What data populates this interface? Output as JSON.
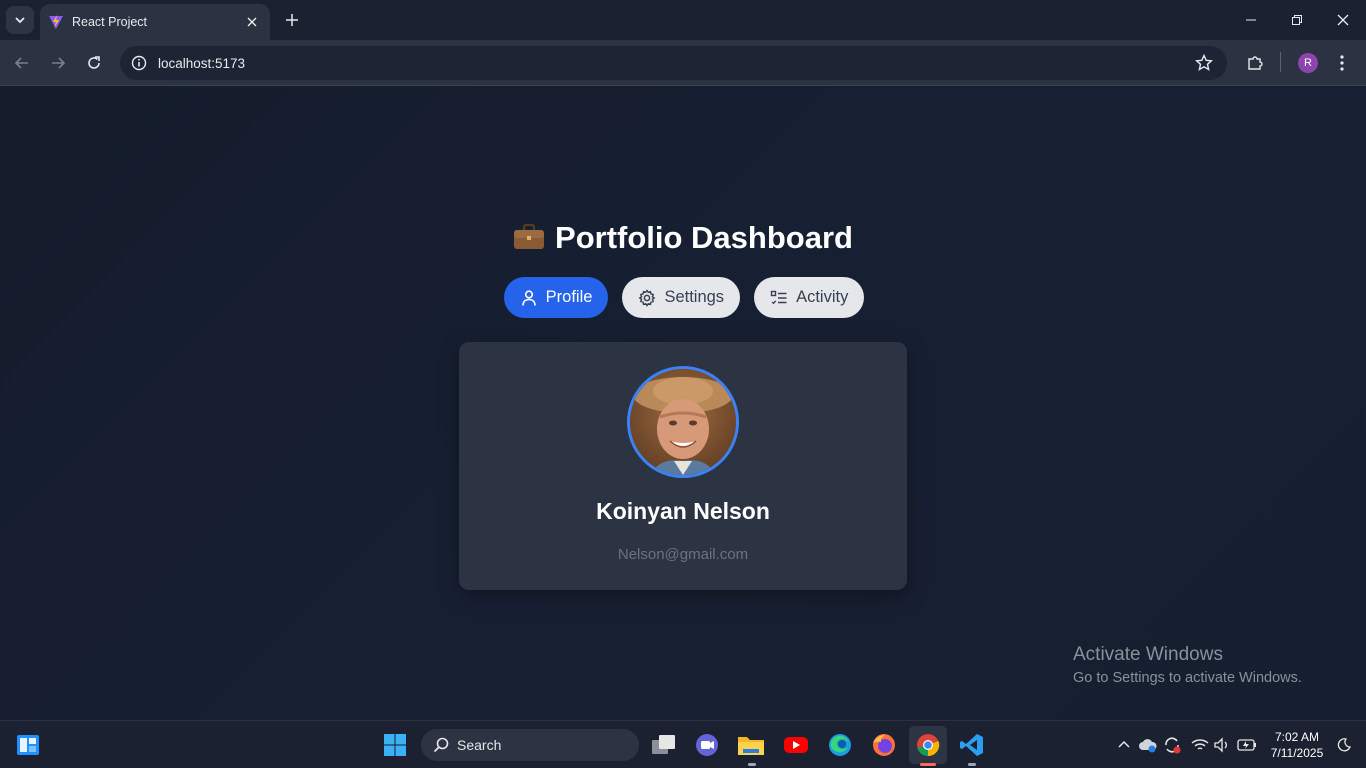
{
  "browser": {
    "tab_title": "React Project",
    "url": "localhost:5173",
    "profile_initial": "R"
  },
  "page": {
    "title": "Portfolio Dashboard",
    "title_icon": "briefcase-emoji",
    "tabs": [
      {
        "label": "Profile",
        "icon": "person-icon",
        "active": true
      },
      {
        "label": "Settings",
        "icon": "gear-icon",
        "active": false
      },
      {
        "label": "Activity",
        "icon": "list-check-icon",
        "active": false
      }
    ],
    "profile": {
      "name": "Koinyan Nelson",
      "email": "Nelson@gmail.com"
    },
    "colors": {
      "accent": "#2563eb",
      "avatar_border": "#3b82f6",
      "card_bg": "#2c3443"
    }
  },
  "watermark": {
    "line1": "Activate Windows",
    "line2": "Go to Settings to activate Windows."
  },
  "taskbar": {
    "search_label": "Search",
    "time": "7:02 AM",
    "date": "7/11/2025"
  }
}
